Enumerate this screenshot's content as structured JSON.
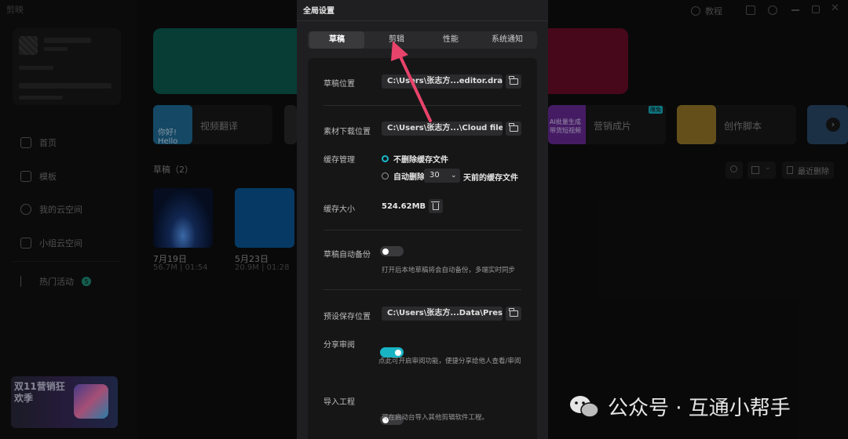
{
  "app": {
    "logo_text": "剪映",
    "nav": [
      {
        "label": "首页",
        "icon": "home-icon"
      },
      {
        "label": "模板",
        "icon": "template-icon"
      },
      {
        "label": "我的云空间",
        "icon": "cloud-icon"
      },
      {
        "label": "小组云空间",
        "icon": "group-icon"
      },
      {
        "label": "热门活动",
        "icon": "flag-icon",
        "badge": "5"
      }
    ],
    "promo_text": "双11营销狂欢季",
    "tools": [
      {
        "label": "视频翻译",
        "thumb_text": "你好! Hello"
      },
      {
        "label": "营销成片",
        "thumb_text": "AI批量生成带货短视频",
        "badge": "限免"
      },
      {
        "label": "创作脚本"
      }
    ],
    "drafts_title": "草稿（2）",
    "drafts": [
      {
        "date": "7月19日",
        "info": "56.7M | 01:54"
      },
      {
        "date": "5月23日",
        "info": "20.9M | 01:28"
      }
    ],
    "top_right_tutorial": "教程",
    "recent_delete": "最近删除"
  },
  "dialog": {
    "title": "全局设置",
    "tabs": [
      "草稿",
      "剪辑",
      "性能",
      "系统通知"
    ],
    "active_tab": "草稿",
    "draft_location_label": "草稿位置",
    "draft_location_path": "C:\\Users\\张志方...editor.draft",
    "download_location_label": "素材下载位置",
    "download_location_path": "C:\\Users\\张志方...\\Cloud files",
    "cache_label": "缓存管理",
    "cache_option_keep": "不删除缓存文件",
    "cache_option_auto_prefix": "自动删除",
    "cache_days": "30",
    "cache_option_auto_suffix": "天前的缓存文件",
    "cache_size_label": "缓存大小",
    "cache_size_value": "524.62MB",
    "auto_backup_label": "草稿自动备份",
    "auto_backup_on": false,
    "auto_backup_hint": "打开后本地草稿将会自动备份，多端实时同步",
    "preset_location_label": "预设保存位置",
    "preset_location_path": "C:\\Users\\张志方...Data\\Presets",
    "share_review_label": "分享审阅",
    "share_review_on": true,
    "share_review_hint": "点此可开启审阅功能，便捷分享给他人查看/审阅",
    "import_project_label": "导入工程",
    "import_project_on": false,
    "import_project_hint": "可在启动台导入其他剪辑软件工程。"
  },
  "watermark": "公众号 · 互通小帮手",
  "colors": {
    "accent": "#19b4c4",
    "arrow": "#e8436a",
    "dialog_bg": "#1f1f21",
    "panel_bg": "#161617"
  }
}
